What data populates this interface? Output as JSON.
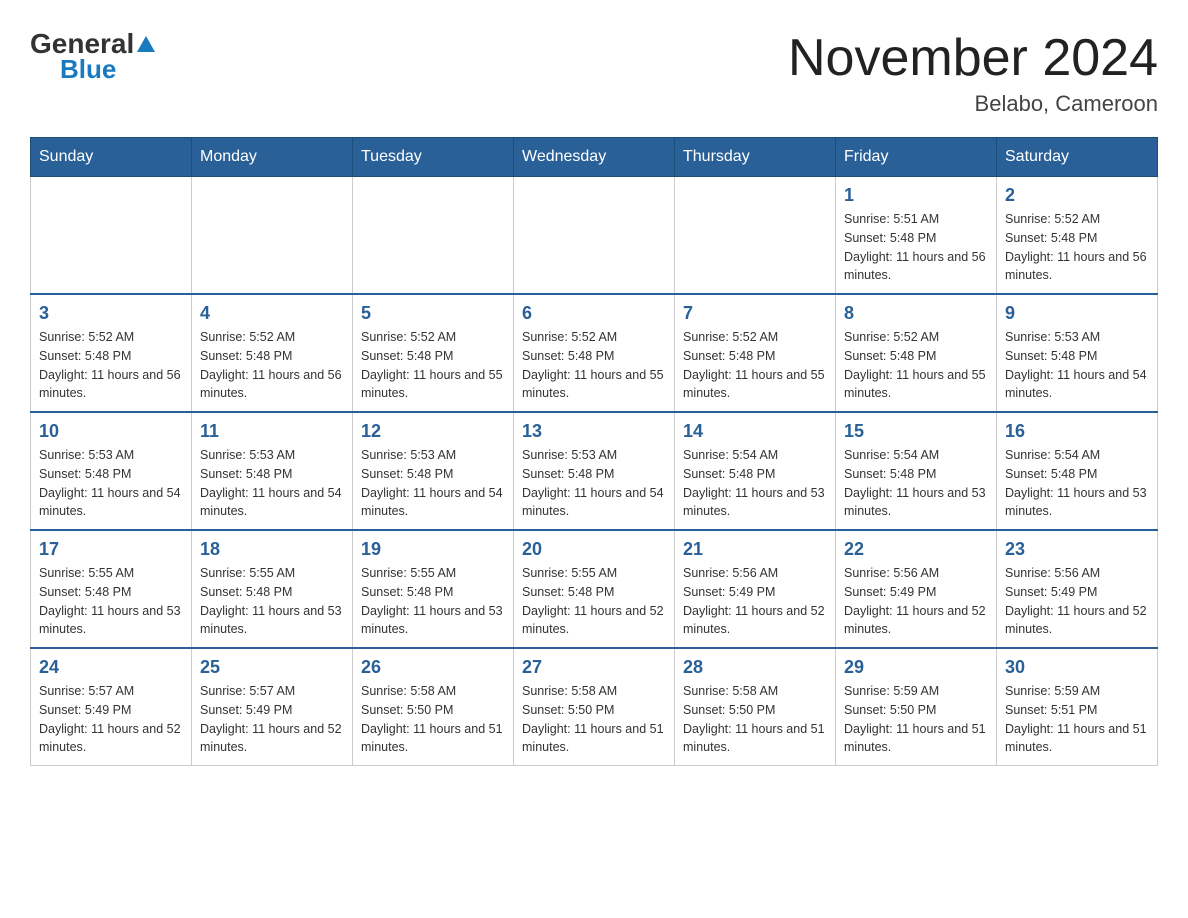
{
  "header": {
    "logo": {
      "general": "General",
      "blue": "Blue"
    },
    "title": "November 2024",
    "location": "Belabo, Cameroon"
  },
  "days_of_week": [
    "Sunday",
    "Monday",
    "Tuesday",
    "Wednesday",
    "Thursday",
    "Friday",
    "Saturday"
  ],
  "weeks": [
    [
      {
        "day": null,
        "info": null
      },
      {
        "day": null,
        "info": null
      },
      {
        "day": null,
        "info": null
      },
      {
        "day": null,
        "info": null
      },
      {
        "day": null,
        "info": null
      },
      {
        "day": "1",
        "info": "Sunrise: 5:51 AM\nSunset: 5:48 PM\nDaylight: 11 hours and 56 minutes."
      },
      {
        "day": "2",
        "info": "Sunrise: 5:52 AM\nSunset: 5:48 PM\nDaylight: 11 hours and 56 minutes."
      }
    ],
    [
      {
        "day": "3",
        "info": "Sunrise: 5:52 AM\nSunset: 5:48 PM\nDaylight: 11 hours and 56 minutes."
      },
      {
        "day": "4",
        "info": "Sunrise: 5:52 AM\nSunset: 5:48 PM\nDaylight: 11 hours and 56 minutes."
      },
      {
        "day": "5",
        "info": "Sunrise: 5:52 AM\nSunset: 5:48 PM\nDaylight: 11 hours and 55 minutes."
      },
      {
        "day": "6",
        "info": "Sunrise: 5:52 AM\nSunset: 5:48 PM\nDaylight: 11 hours and 55 minutes."
      },
      {
        "day": "7",
        "info": "Sunrise: 5:52 AM\nSunset: 5:48 PM\nDaylight: 11 hours and 55 minutes."
      },
      {
        "day": "8",
        "info": "Sunrise: 5:52 AM\nSunset: 5:48 PM\nDaylight: 11 hours and 55 minutes."
      },
      {
        "day": "9",
        "info": "Sunrise: 5:53 AM\nSunset: 5:48 PM\nDaylight: 11 hours and 54 minutes."
      }
    ],
    [
      {
        "day": "10",
        "info": "Sunrise: 5:53 AM\nSunset: 5:48 PM\nDaylight: 11 hours and 54 minutes."
      },
      {
        "day": "11",
        "info": "Sunrise: 5:53 AM\nSunset: 5:48 PM\nDaylight: 11 hours and 54 minutes."
      },
      {
        "day": "12",
        "info": "Sunrise: 5:53 AM\nSunset: 5:48 PM\nDaylight: 11 hours and 54 minutes."
      },
      {
        "day": "13",
        "info": "Sunrise: 5:53 AM\nSunset: 5:48 PM\nDaylight: 11 hours and 54 minutes."
      },
      {
        "day": "14",
        "info": "Sunrise: 5:54 AM\nSunset: 5:48 PM\nDaylight: 11 hours and 53 minutes."
      },
      {
        "day": "15",
        "info": "Sunrise: 5:54 AM\nSunset: 5:48 PM\nDaylight: 11 hours and 53 minutes."
      },
      {
        "day": "16",
        "info": "Sunrise: 5:54 AM\nSunset: 5:48 PM\nDaylight: 11 hours and 53 minutes."
      }
    ],
    [
      {
        "day": "17",
        "info": "Sunrise: 5:55 AM\nSunset: 5:48 PM\nDaylight: 11 hours and 53 minutes."
      },
      {
        "day": "18",
        "info": "Sunrise: 5:55 AM\nSunset: 5:48 PM\nDaylight: 11 hours and 53 minutes."
      },
      {
        "day": "19",
        "info": "Sunrise: 5:55 AM\nSunset: 5:48 PM\nDaylight: 11 hours and 53 minutes."
      },
      {
        "day": "20",
        "info": "Sunrise: 5:55 AM\nSunset: 5:48 PM\nDaylight: 11 hours and 52 minutes."
      },
      {
        "day": "21",
        "info": "Sunrise: 5:56 AM\nSunset: 5:49 PM\nDaylight: 11 hours and 52 minutes."
      },
      {
        "day": "22",
        "info": "Sunrise: 5:56 AM\nSunset: 5:49 PM\nDaylight: 11 hours and 52 minutes."
      },
      {
        "day": "23",
        "info": "Sunrise: 5:56 AM\nSunset: 5:49 PM\nDaylight: 11 hours and 52 minutes."
      }
    ],
    [
      {
        "day": "24",
        "info": "Sunrise: 5:57 AM\nSunset: 5:49 PM\nDaylight: 11 hours and 52 minutes."
      },
      {
        "day": "25",
        "info": "Sunrise: 5:57 AM\nSunset: 5:49 PM\nDaylight: 11 hours and 52 minutes."
      },
      {
        "day": "26",
        "info": "Sunrise: 5:58 AM\nSunset: 5:50 PM\nDaylight: 11 hours and 51 minutes."
      },
      {
        "day": "27",
        "info": "Sunrise: 5:58 AM\nSunset: 5:50 PM\nDaylight: 11 hours and 51 minutes."
      },
      {
        "day": "28",
        "info": "Sunrise: 5:58 AM\nSunset: 5:50 PM\nDaylight: 11 hours and 51 minutes."
      },
      {
        "day": "29",
        "info": "Sunrise: 5:59 AM\nSunset: 5:50 PM\nDaylight: 11 hours and 51 minutes."
      },
      {
        "day": "30",
        "info": "Sunrise: 5:59 AM\nSunset: 5:51 PM\nDaylight: 11 hours and 51 minutes."
      }
    ]
  ]
}
